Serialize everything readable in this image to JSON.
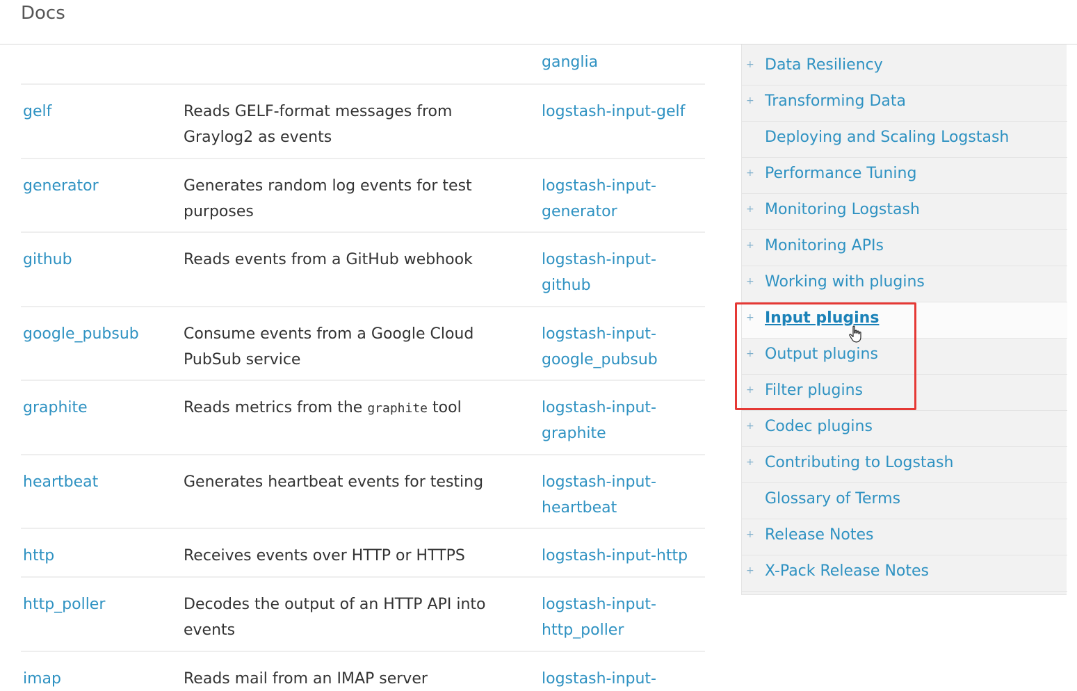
{
  "header": {
    "title": "Docs"
  },
  "rows": [
    {
      "plugin": "",
      "description": "",
      "repo": "ganglia"
    },
    {
      "plugin": "gelf",
      "description": "Reads GELF-format messages from Graylog2 as events",
      "repo": "logstash-input-gelf"
    },
    {
      "plugin": "generator",
      "description": "Generates random log events for test purposes",
      "repo": "logstash-input-generator"
    },
    {
      "plugin": "github",
      "description": "Reads events from a GitHub webhook",
      "repo": "logstash-input-github"
    },
    {
      "plugin": "google_pubsub",
      "description": "Consume events from a Google Cloud PubSub service",
      "repo": "logstash-input-google_pubsub"
    },
    {
      "plugin": "graphite",
      "description_pre": "Reads metrics from the ",
      "description_code": "graphite",
      "description_post": " tool",
      "repo": "logstash-input-graphite"
    },
    {
      "plugin": "heartbeat",
      "description": "Generates heartbeat events for testing",
      "repo": "logstash-input-heartbeat"
    },
    {
      "plugin": "http",
      "description": "Receives events over HTTP or HTTPS",
      "repo": "logstash-input-http"
    },
    {
      "plugin": "http_poller",
      "description": "Decodes the output of an HTTP API into events",
      "repo": "logstash-input-http_poller"
    },
    {
      "plugin": "imap",
      "description": "Reads mail from an IMAP server",
      "repo": "logstash-input-"
    }
  ],
  "sidebar": {
    "items": [
      {
        "label": "Data Resiliency",
        "expandable": true
      },
      {
        "label": "Transforming Data",
        "expandable": true
      },
      {
        "label": "Deploying and Scaling Logstash",
        "expandable": false
      },
      {
        "label": "Performance Tuning",
        "expandable": true
      },
      {
        "label": "Monitoring Logstash",
        "expandable": true
      },
      {
        "label": "Monitoring APIs",
        "expandable": true
      },
      {
        "label": "Working with plugins",
        "expandable": true
      },
      {
        "label": "Input plugins",
        "expandable": true,
        "active": true
      },
      {
        "label": "Output plugins",
        "expandable": true
      },
      {
        "label": "Filter plugins",
        "expandable": true
      },
      {
        "label": "Codec plugins",
        "expandable": true
      },
      {
        "label": "Contributing to Logstash",
        "expandable": true
      },
      {
        "label": "Glossary of Terms",
        "expandable": false
      },
      {
        "label": "Release Notes",
        "expandable": true
      },
      {
        "label": "X-Pack Release Notes",
        "expandable": true
      }
    ],
    "plus_glyph": "+"
  },
  "colors": {
    "link": "#2f92c2",
    "highlight": "#e53935",
    "sidebar_bg": "#f2f2f2"
  }
}
